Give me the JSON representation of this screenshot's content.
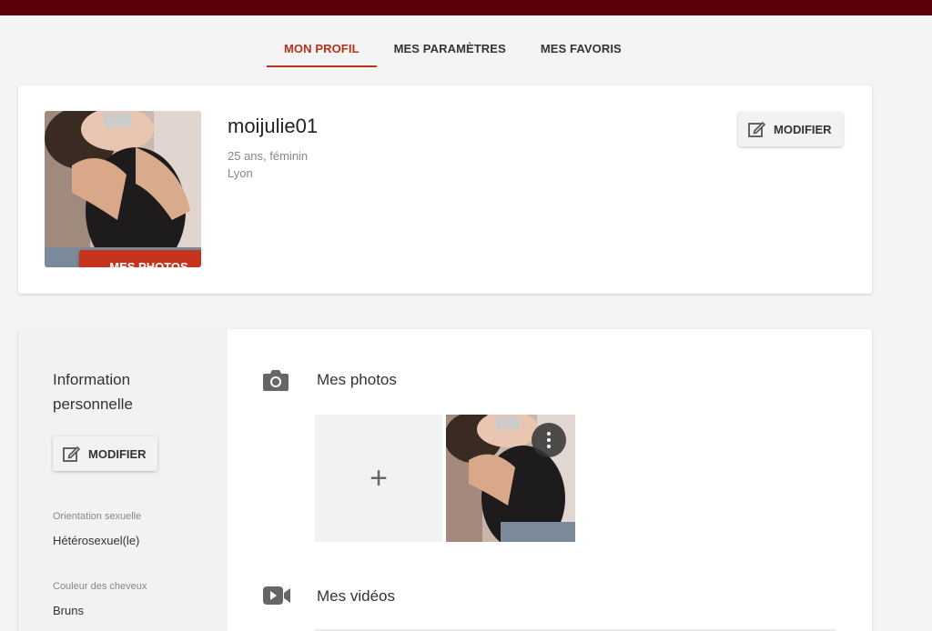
{
  "tabs": [
    {
      "label": "MON PROFIL",
      "active": true
    },
    {
      "label": "MES PARAMÈTRES",
      "active": false
    },
    {
      "label": "MES FAVORIS",
      "active": false
    }
  ],
  "profile": {
    "username": "moijulie01",
    "age_gender": "25 ans, féminin",
    "city": "Lyon",
    "photos_button": "MES PHOTOS",
    "modify_button": "MODIFIER"
  },
  "personal": {
    "title": "Information personnelle",
    "modify_button": "MODIFIER",
    "fields": [
      {
        "label": "Orientation sexuelle",
        "value": "Hétérosexuel(le)"
      },
      {
        "label": "Couleur des cheveux",
        "value": "Bruns"
      }
    ]
  },
  "media": {
    "photos_title": "Mes photos",
    "add_symbol": "+",
    "videos_title": "Mes vidéos"
  },
  "colors": {
    "topbar": "#5a0008",
    "accent": "#b73218",
    "photos_button": "#c7331d"
  },
  "icons": {
    "edit": "edit-icon",
    "camera": "camera-icon",
    "video": "video-icon",
    "more": "more-vert-icon"
  }
}
